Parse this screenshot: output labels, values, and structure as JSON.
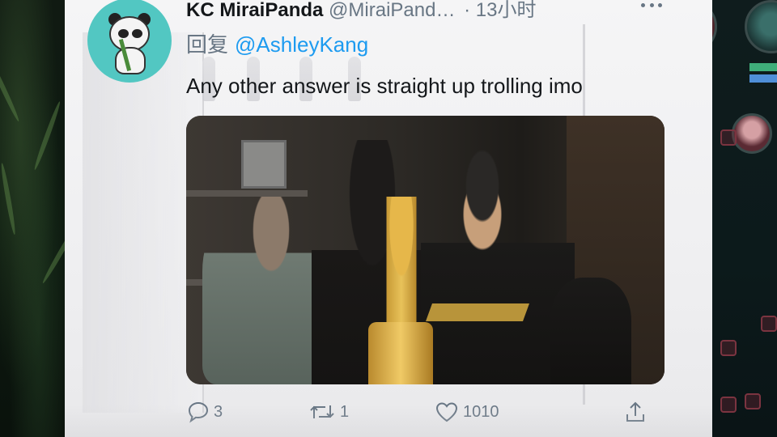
{
  "tweet": {
    "author_name": "KC MiraiPanda",
    "author_handle": "@MiraiPand…",
    "time": "· 13小时",
    "reply_prefix": "回复",
    "reply_to": "@AshleyKang",
    "text": "Any other answer is straight up trolling imo",
    "actions": {
      "reply_count": "3",
      "retweet_count": "1",
      "like_count": "1010"
    }
  },
  "icons": {
    "reply": "comment-icon",
    "retweet": "retweet-icon",
    "like": "heart-icon",
    "share": "share-icon",
    "more": "more-icon"
  },
  "colors": {
    "link": "#1d9bf0",
    "secondary_text": "#687684",
    "primary_text": "#14171a",
    "avatar_bg": "#52c7c2"
  }
}
